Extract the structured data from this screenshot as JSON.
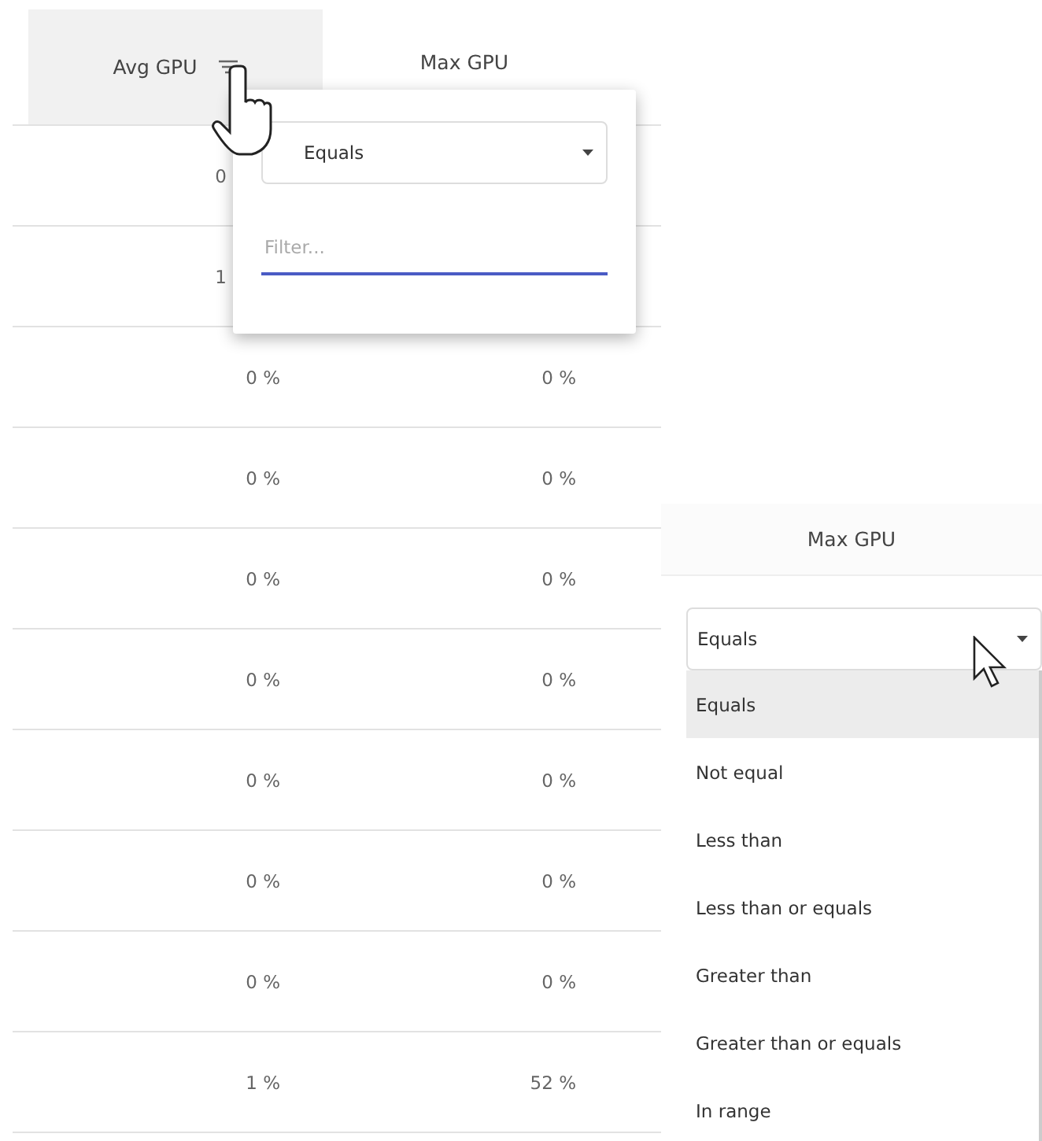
{
  "table": {
    "columns": [
      {
        "label": "Avg GPU",
        "menu_open": true
      },
      {
        "label": "Max GPU",
        "menu_open": false
      }
    ],
    "partial_rows": [
      {
        "avg": "0"
      },
      {
        "avg": "1"
      }
    ],
    "rows": [
      {
        "avg": "0 %",
        "max": "0 %"
      },
      {
        "avg": "0 %",
        "max": "0 %"
      },
      {
        "avg": "0 %",
        "max": "0 %"
      },
      {
        "avg": "0 %",
        "max": "0 %"
      },
      {
        "avg": "0 %",
        "max": "0 %"
      },
      {
        "avg": "0 %",
        "max": "0 %"
      },
      {
        "avg": "0 %",
        "max": "0 %"
      },
      {
        "avg": "1 %",
        "max": "52 %"
      }
    ]
  },
  "filter_popup": {
    "operator": "Equals",
    "placeholder": "Filter..."
  },
  "zoomed_filter": {
    "column": "Max GPU",
    "operator": "Equals",
    "options": [
      {
        "label": "Equals",
        "selected": true
      },
      {
        "label": "Not equal",
        "selected": false
      },
      {
        "label": "Less than",
        "selected": false
      },
      {
        "label": "Less than or equals",
        "selected": false
      },
      {
        "label": "Greater than",
        "selected": false
      },
      {
        "label": "Greater than or equals",
        "selected": false
      },
      {
        "label": "In range",
        "selected": false
      }
    ]
  }
}
